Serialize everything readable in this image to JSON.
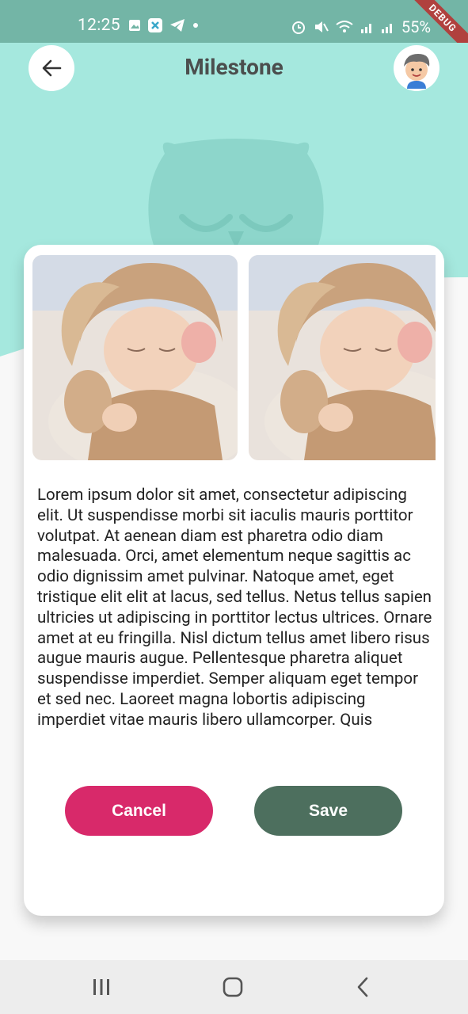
{
  "status_bar": {
    "time": "12:25",
    "battery": "55%",
    "debug_label": "DEBUG"
  },
  "header": {
    "title": "Milestone"
  },
  "card": {
    "body_text": "Lorem ipsum dolor sit amet, consectetur adipiscing elit. Ut suspendisse morbi sit iaculis mauris porttitor volutpat. At aenean diam est pharetra odio diam malesuada. Orci, amet elementum neque sagittis ac odio dignissim amet pulvinar. Natoque amet, eget tristique elit elit at lacus, sed tellus. Netus tellus sapien ultricies ut adipiscing in porttitor lectus ultrices. Ornare amet at eu fringilla. Nisl dictum tellus amet libero risus augue mauris augue. Pellentesque pharetra aliquet suspendisse imperdiet. Semper aliquam eget tempor et sed nec. Laoreet magna lobortis adipiscing imperdiet vitae mauris libero ullamcorper. Quis",
    "cancel_label": "Cancel",
    "save_label": "Save"
  },
  "colors": {
    "status_bar": "#73b5a6",
    "hero": "#a5e8de",
    "cancel": "#d8296a",
    "save": "#4d6f5e",
    "title": "#4b4e4d"
  },
  "icons": {
    "back": "arrow-left-icon",
    "avatar": "boy-avatar-icon",
    "nav_recents": "recents-icon",
    "nav_home": "home-icon",
    "nav_back": "chevron-left-icon"
  }
}
